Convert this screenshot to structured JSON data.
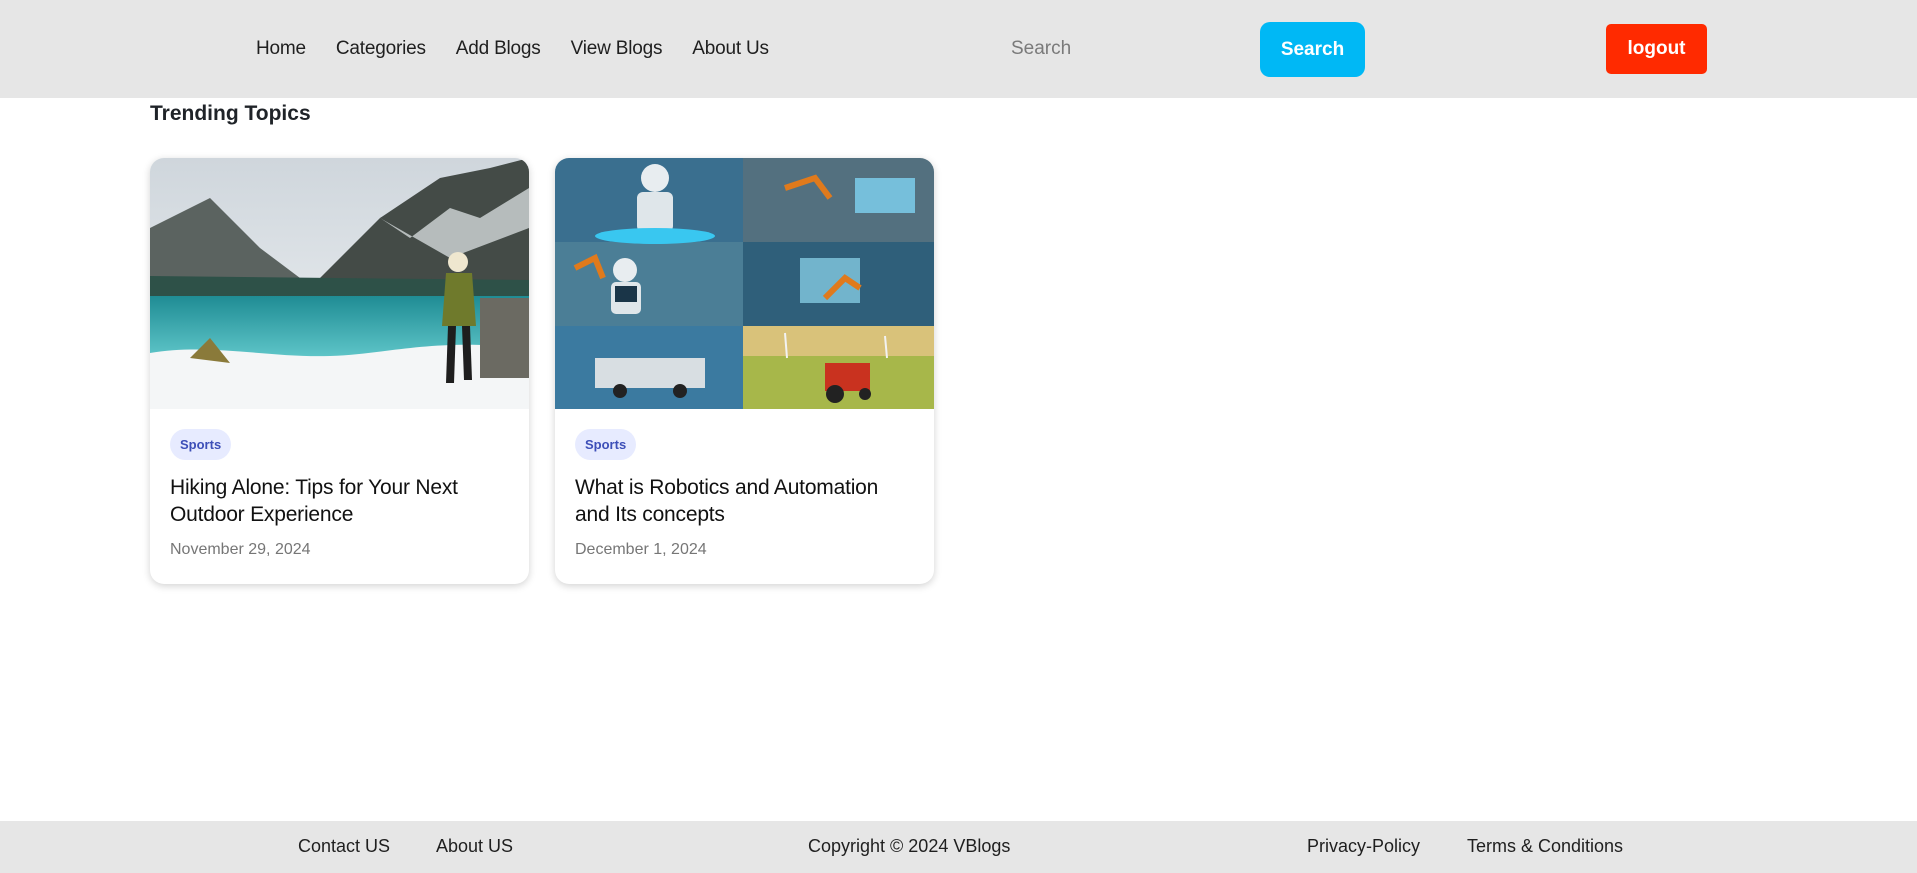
{
  "nav": {
    "items": [
      "Home",
      "Categories",
      "Add Blogs",
      "View Blogs",
      "About Us"
    ]
  },
  "search": {
    "placeholder": "Search",
    "button_label": "Search"
  },
  "logout_label": "logout",
  "section_title": "Trending Topics",
  "cards": [
    {
      "tag": "Sports",
      "title": "Hiking Alone: Tips for Your Next Outdoor Experience",
      "date": "November 29, 2024",
      "image": "mountain-lake-hiker-photo"
    },
    {
      "tag": "Sports",
      "title": "What is Robotics and Automation and Its concepts",
      "date": "December 1, 2024",
      "image": "robotics-collage-photo"
    }
  ],
  "footer": {
    "contact": "Contact US",
    "about": "About US",
    "copyright": "Copyright © 2024 VBlogs",
    "privacy": "Privacy-Policy",
    "terms": "Terms & Conditions"
  },
  "colors": {
    "header_bg": "#e6e6e6",
    "search_button": "#00b8f5",
    "logout_button": "#ff2a00",
    "tag_bg": "#e7ebff",
    "tag_text": "#3d4fb8"
  }
}
